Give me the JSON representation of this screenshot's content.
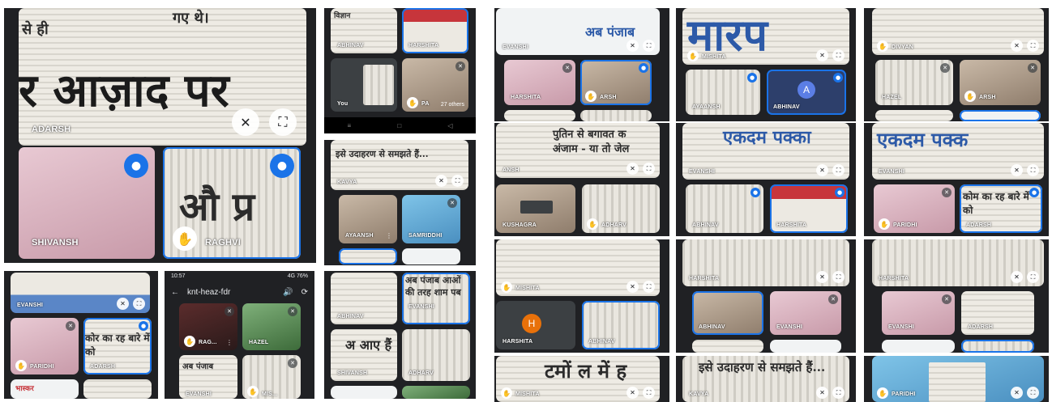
{
  "s1": {
    "overlay_top": "गए थे।",
    "overlay_left": "से ही",
    "headline": "र आज़ाद पर",
    "tile2_text": "औ प्र",
    "names": {
      "adarsh": "ADARSH",
      "shivansh": "SHIVANSH",
      "raghvi": "RAGHVI"
    }
  },
  "s2": {
    "paper_text": "विज्ञान",
    "names": {
      "abhinav": "ABHINAV",
      "harshita": "HARSHITA",
      "you": "You",
      "pa": "PA"
    },
    "others": "27 others"
  },
  "s3": {
    "paper_text": "इसे उदाहरण से समझते हैं...",
    "names": {
      "kavya": "KAVYA",
      "ayaansh": "AYAANSH",
      "samriddhi": "SAMRIDDHI"
    }
  },
  "s4": {
    "names": {
      "evanshi": "EVANSHI",
      "paridhi": "PARIDHI",
      "adarsh": "ADARSH"
    },
    "paper_text": "कोर का रह बारे में को",
    "bottom_text": "भास्कर"
  },
  "s5": {
    "status_time": "10:57",
    "status_right": "4G 76%",
    "meeting_code": "knt-heaz-fdr",
    "names": {
      "rag": "RAG...",
      "hazel": "HAZEL",
      "evanshi": "EVANSHI",
      "mis": "MIS..."
    },
    "paper_text": "अब पंजाब"
  },
  "s6": {
    "paper_text": "अब पंजाब आओं की तरह शाम पब",
    "paper_text2": "अ आए हैं",
    "names": {
      "abhinav": "ABHINAV",
      "evanshi": "EVANSHI",
      "shivansh": "SHIVANSH",
      "adharv": "ADHARV"
    }
  },
  "s7": {
    "paper_text": "अब पंजाब",
    "names": {
      "evanshi": "EVANSHI",
      "harshita": "HARSHITA",
      "arsh": "ARSH"
    }
  },
  "s8": {
    "paper_text": "मारप",
    "avatar": "A",
    "avatar_color": "#5b7ee5",
    "names": {
      "mishita": "MISHITA",
      "ayaansh": "AYAANSH",
      "abhinav": "ABHINAV"
    }
  },
  "s9": {
    "names": {
      "divyan": "DIVYAN",
      "hazel": "HAZEL",
      "arsh": "ARSH"
    }
  },
  "s10": {
    "paper_text": "पुतिन से बगावत क अंजाम - या तो जेल",
    "names": {
      "ansh": "ANSH",
      "kushagra": "KUSHAGRA",
      "adharv": "ADHARV"
    }
  },
  "s11": {
    "paper_text": "एकदम पक्का",
    "names": {
      "evanshi": "EVANSHI",
      "abhinav": "ABHINAV",
      "harshita": "HARSHITA"
    }
  },
  "s12": {
    "paper_text": "एकदम पक्क",
    "paper_text2": "कोम का रह बारे में को",
    "names": {
      "evanshi": "EVANSHI",
      "paridhi": "PARIDHI",
      "adarsh": "ADARSH"
    }
  },
  "s13": {
    "avatar": "H",
    "avatar_color": "#e8710a",
    "names": {
      "mishita": "MISHITA",
      "harshita": "HARSHITA",
      "abhinav": "ABHINAV"
    }
  },
  "s14": {
    "names": {
      "harshita": "HARSHITA",
      "abhinav": "ABHINAV",
      "evanshi": "EVANSHI"
    }
  },
  "s15": {
    "names": {
      "harshita": "HARSHITA",
      "evanshi": "EVANSHI",
      "adarsh": "ADARSH"
    }
  },
  "s16": {
    "paper_text": "टमों ल में ह",
    "names": {
      "mishita": "MISHITA"
    }
  },
  "s17": {
    "paper_text": "इसे उदाहरण से समझते हैं...",
    "names": {
      "kavya": "KAVYA"
    }
  },
  "s18": {
    "names": {
      "paridhi": "PARIDHI"
    }
  },
  "icons": {
    "mic": "mic-icon",
    "mic_off": "mic-off-icon",
    "pin_off": "pin-off-icon",
    "fullscreen": "fullscreen-icon",
    "raised_hand": "raised-hand-icon",
    "more": "more-options-icon"
  }
}
